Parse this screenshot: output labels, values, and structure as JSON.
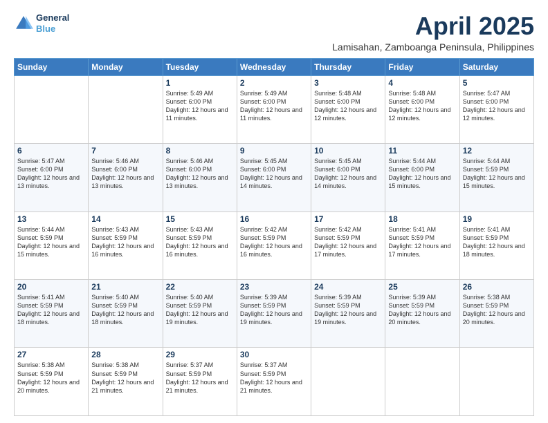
{
  "header": {
    "logo_line1": "General",
    "logo_line2": "Blue",
    "month_title": "April 2025",
    "location": "Lamisahan, Zamboanga Peninsula, Philippines"
  },
  "weekdays": [
    "Sunday",
    "Monday",
    "Tuesday",
    "Wednesday",
    "Thursday",
    "Friday",
    "Saturday"
  ],
  "weeks": [
    [
      {
        "day": "",
        "info": ""
      },
      {
        "day": "",
        "info": ""
      },
      {
        "day": "1",
        "info": "Sunrise: 5:49 AM\nSunset: 6:00 PM\nDaylight: 12 hours and 11 minutes."
      },
      {
        "day": "2",
        "info": "Sunrise: 5:49 AM\nSunset: 6:00 PM\nDaylight: 12 hours and 11 minutes."
      },
      {
        "day": "3",
        "info": "Sunrise: 5:48 AM\nSunset: 6:00 PM\nDaylight: 12 hours and 12 minutes."
      },
      {
        "day": "4",
        "info": "Sunrise: 5:48 AM\nSunset: 6:00 PM\nDaylight: 12 hours and 12 minutes."
      },
      {
        "day": "5",
        "info": "Sunrise: 5:47 AM\nSunset: 6:00 PM\nDaylight: 12 hours and 12 minutes."
      }
    ],
    [
      {
        "day": "6",
        "info": "Sunrise: 5:47 AM\nSunset: 6:00 PM\nDaylight: 12 hours and 13 minutes."
      },
      {
        "day": "7",
        "info": "Sunrise: 5:46 AM\nSunset: 6:00 PM\nDaylight: 12 hours and 13 minutes."
      },
      {
        "day": "8",
        "info": "Sunrise: 5:46 AM\nSunset: 6:00 PM\nDaylight: 12 hours and 13 minutes."
      },
      {
        "day": "9",
        "info": "Sunrise: 5:45 AM\nSunset: 6:00 PM\nDaylight: 12 hours and 14 minutes."
      },
      {
        "day": "10",
        "info": "Sunrise: 5:45 AM\nSunset: 6:00 PM\nDaylight: 12 hours and 14 minutes."
      },
      {
        "day": "11",
        "info": "Sunrise: 5:44 AM\nSunset: 6:00 PM\nDaylight: 12 hours and 15 minutes."
      },
      {
        "day": "12",
        "info": "Sunrise: 5:44 AM\nSunset: 5:59 PM\nDaylight: 12 hours and 15 minutes."
      }
    ],
    [
      {
        "day": "13",
        "info": "Sunrise: 5:44 AM\nSunset: 5:59 PM\nDaylight: 12 hours and 15 minutes."
      },
      {
        "day": "14",
        "info": "Sunrise: 5:43 AM\nSunset: 5:59 PM\nDaylight: 12 hours and 16 minutes."
      },
      {
        "day": "15",
        "info": "Sunrise: 5:43 AM\nSunset: 5:59 PM\nDaylight: 12 hours and 16 minutes."
      },
      {
        "day": "16",
        "info": "Sunrise: 5:42 AM\nSunset: 5:59 PM\nDaylight: 12 hours and 16 minutes."
      },
      {
        "day": "17",
        "info": "Sunrise: 5:42 AM\nSunset: 5:59 PM\nDaylight: 12 hours and 17 minutes."
      },
      {
        "day": "18",
        "info": "Sunrise: 5:41 AM\nSunset: 5:59 PM\nDaylight: 12 hours and 17 minutes."
      },
      {
        "day": "19",
        "info": "Sunrise: 5:41 AM\nSunset: 5:59 PM\nDaylight: 12 hours and 18 minutes."
      }
    ],
    [
      {
        "day": "20",
        "info": "Sunrise: 5:41 AM\nSunset: 5:59 PM\nDaylight: 12 hours and 18 minutes."
      },
      {
        "day": "21",
        "info": "Sunrise: 5:40 AM\nSunset: 5:59 PM\nDaylight: 12 hours and 18 minutes."
      },
      {
        "day": "22",
        "info": "Sunrise: 5:40 AM\nSunset: 5:59 PM\nDaylight: 12 hours and 19 minutes."
      },
      {
        "day": "23",
        "info": "Sunrise: 5:39 AM\nSunset: 5:59 PM\nDaylight: 12 hours and 19 minutes."
      },
      {
        "day": "24",
        "info": "Sunrise: 5:39 AM\nSunset: 5:59 PM\nDaylight: 12 hours and 19 minutes."
      },
      {
        "day": "25",
        "info": "Sunrise: 5:39 AM\nSunset: 5:59 PM\nDaylight: 12 hours and 20 minutes."
      },
      {
        "day": "26",
        "info": "Sunrise: 5:38 AM\nSunset: 5:59 PM\nDaylight: 12 hours and 20 minutes."
      }
    ],
    [
      {
        "day": "27",
        "info": "Sunrise: 5:38 AM\nSunset: 5:59 PM\nDaylight: 12 hours and 20 minutes."
      },
      {
        "day": "28",
        "info": "Sunrise: 5:38 AM\nSunset: 5:59 PM\nDaylight: 12 hours and 21 minutes."
      },
      {
        "day": "29",
        "info": "Sunrise: 5:37 AM\nSunset: 5:59 PM\nDaylight: 12 hours and 21 minutes."
      },
      {
        "day": "30",
        "info": "Sunrise: 5:37 AM\nSunset: 5:59 PM\nDaylight: 12 hours and 21 minutes."
      },
      {
        "day": "",
        "info": ""
      },
      {
        "day": "",
        "info": ""
      },
      {
        "day": "",
        "info": ""
      }
    ]
  ]
}
